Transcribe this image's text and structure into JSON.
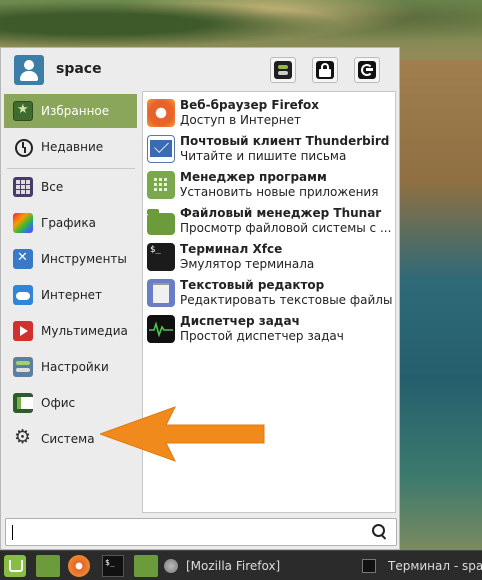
{
  "header": {
    "username": "space"
  },
  "sidebar": {
    "items": [
      {
        "label": "Избранное",
        "icon": "favorites-icon",
        "selected": true
      },
      {
        "label": "Недавние",
        "icon": "recent-icon"
      },
      {
        "label": "Все",
        "icon": "all-apps-icon"
      },
      {
        "label": "Графика",
        "icon": "graphics-icon"
      },
      {
        "label": "Инструменты",
        "icon": "tools-icon"
      },
      {
        "label": "Интернет",
        "icon": "internet-icon"
      },
      {
        "label": "Мультимедиа",
        "icon": "multimedia-icon"
      },
      {
        "label": "Настройки",
        "icon": "settings-icon"
      },
      {
        "label": "Офис",
        "icon": "office-icon"
      },
      {
        "label": "Система",
        "icon": "system-icon"
      }
    ]
  },
  "apps": [
    {
      "name": "Веб-браузер Firefox",
      "desc": "Доступ в Интернет",
      "icon": "firefox-icon"
    },
    {
      "name": "Почтовый клиент Thunderbird",
      "desc": "Читайте и пишите письма",
      "icon": "mail-icon"
    },
    {
      "name": "Менеджер программ",
      "desc": "Установить новые приложения",
      "icon": "software-manager-icon"
    },
    {
      "name": "Файловый менеджер Thunar",
      "desc": "Просмотр файловой системы с ...",
      "icon": "folder-icon"
    },
    {
      "name": "Терминал Xfce",
      "desc": "Эмулятор терминала",
      "icon": "terminal-icon"
    },
    {
      "name": "Текстовый редактор",
      "desc": "Редактировать текстовые файлы",
      "icon": "text-editor-icon"
    },
    {
      "name": "Диспетчер задач",
      "desc": "Простой диспетчер задач",
      "icon": "task-manager-icon"
    }
  ],
  "search": {
    "value": "",
    "placeholder": ""
  },
  "taskbar": {
    "firefox_window": "[Mozilla Firefox]",
    "terminal_window": "Терминал - spa"
  },
  "colors": {
    "selected": "#8aa65a",
    "annotation_arrow": "#f08a1c",
    "taskbar": "#2b2b2b"
  }
}
